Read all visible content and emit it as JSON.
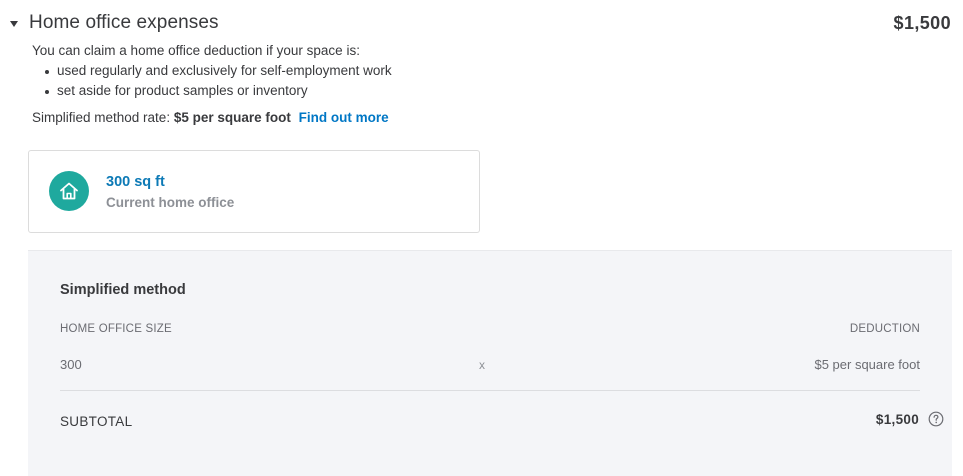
{
  "header": {
    "title": "Home office expenses",
    "total": "$1,500",
    "caret_icon": "caret-down-icon"
  },
  "intro": {
    "text": "You can claim a home office deduction if your space is:",
    "bullets": [
      "used regularly and exclusively for self-employment work",
      "set aside for product samples or inventory"
    ]
  },
  "rate": {
    "label": "Simplified method rate:",
    "value": "$5 per square foot",
    "link": "Find out more"
  },
  "card": {
    "icon": "home-icon",
    "icon_color": "#1fa99e",
    "value": "300 sq ft",
    "label": "Current home office"
  },
  "panel": {
    "title": "Simplified method",
    "col_left": "HOME OFFICE SIZE",
    "col_right": "DEDUCTION",
    "size_value": "300",
    "operator": "x",
    "deduction_value": "$5 per square foot",
    "subtotal_label": "SUBTOTAL",
    "subtotal_value": "$1,500",
    "help_icon": "question-circle-icon"
  },
  "colors": {
    "link": "#0077c5",
    "accent": "#1fa99e",
    "panel_bg": "#f4f5f8"
  }
}
